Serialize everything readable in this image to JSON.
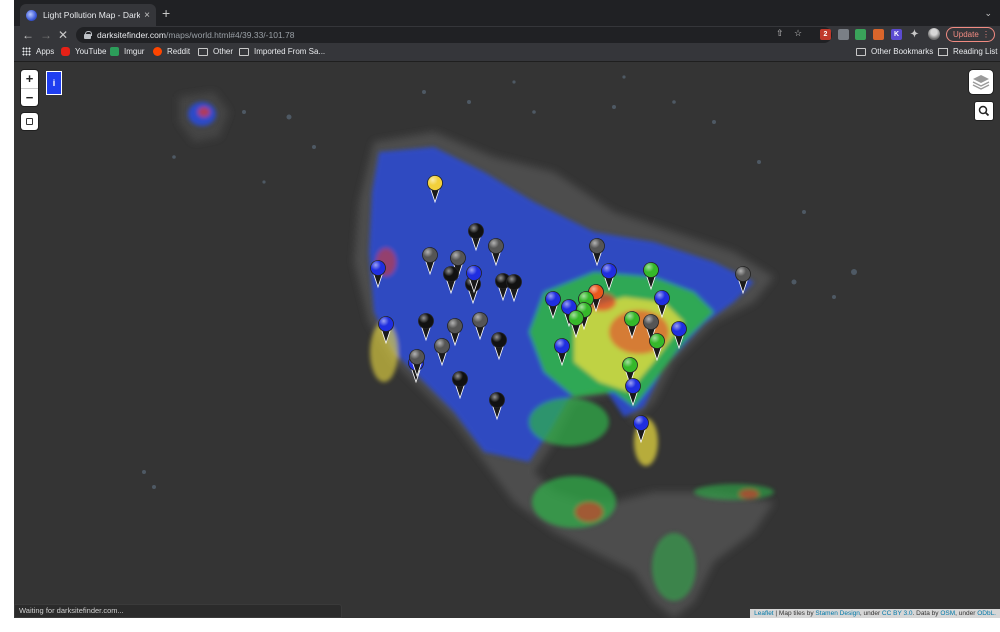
{
  "tab": {
    "title": "Light Pollution Map - DarkSiteFinder.com",
    "close": "×",
    "new_tab": "+",
    "menu": "⌄"
  },
  "omnibox": {
    "host": "darksitefinder.com",
    "path": "/maps/world.html#4/39.33/-101.78"
  },
  "toolbar": {
    "update_label": "Update",
    "update_menu": "⋮",
    "extension_badge": "2",
    "extension_k": "K"
  },
  "bookmarks": [
    {
      "label": "Apps",
      "icon": "apps-grid-icon"
    },
    {
      "label": "YouTube",
      "icon": "youtube-icon"
    },
    {
      "label": "Imgur",
      "icon": "imgur-icon"
    },
    {
      "label": "Reddit",
      "icon": "reddit-icon"
    },
    {
      "label": "Other",
      "icon": "folder-icon"
    },
    {
      "label": "Imported From Sa...",
      "icon": "folder-icon"
    }
  ],
  "bookmarks_right": [
    {
      "label": "Other Bookmarks",
      "icon": "folder-icon"
    },
    {
      "label": "Reading List",
      "icon": "reading-list-icon"
    }
  ],
  "map": {
    "zoom_in": "+",
    "zoom_out": "−",
    "info_label": "i",
    "attribution": {
      "leaflet": "Leaflet",
      "sep1": " | Map tiles by ",
      "stamen": "Stamen Design",
      "sep2": ", under ",
      "cc": "CC BY 3.0",
      "sep3": ". Data by ",
      "osm": "OSM",
      "sep4": ", under ",
      "odbl": "ODbL."
    },
    "marker_colors": {
      "yellow": "#f2d03b",
      "blue": "#1f2ee0",
      "green": "#35b82a",
      "orange": "#e8561c",
      "black": "#111111",
      "gray": "#555555"
    },
    "light_colors": {
      "low": "#2a4bd6",
      "mid": "#2fb34a",
      "high": "#f0e040",
      "peak": "#e8342a"
    }
  },
  "status": "Waiting for darksitefinder.com..."
}
